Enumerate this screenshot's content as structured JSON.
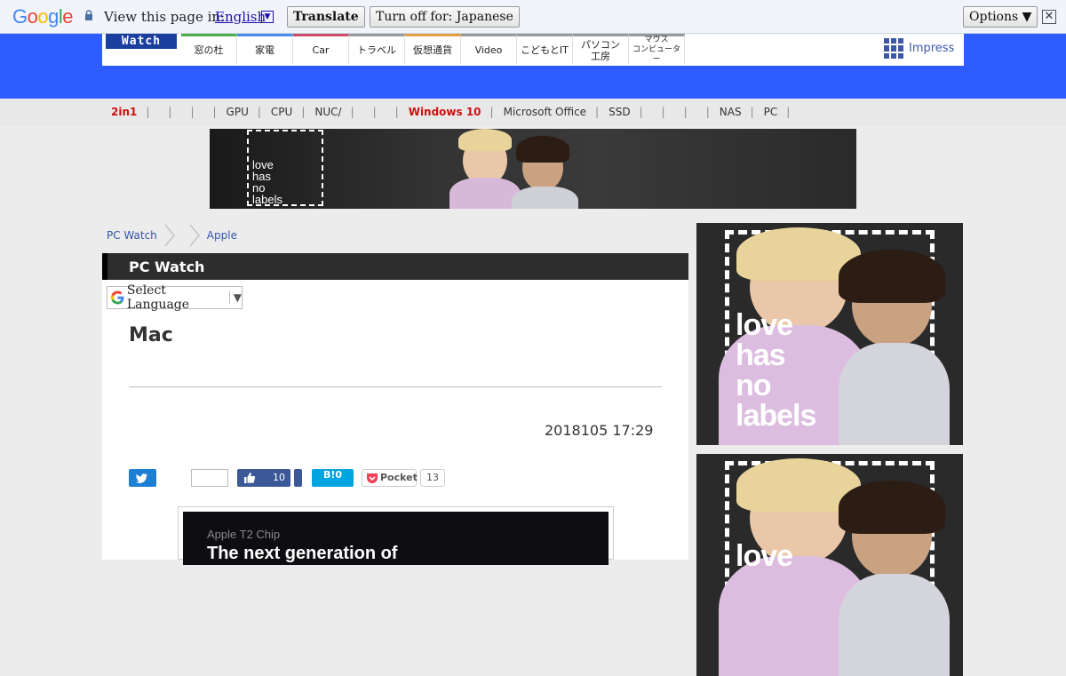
{
  "translate_bar": {
    "logo": "Google",
    "prompt": "View this page in:",
    "language": "English",
    "translate_button": "Translate",
    "turn_off_button": "Turn off for: Japanese",
    "options_button": "Options ▼",
    "close_glyph": "✕"
  },
  "header": {
    "logo_text": "Watch",
    "site_tabs": [
      {
        "label": "窓の杜",
        "color": "#4caf50"
      },
      {
        "label": "家電",
        "color": "#4a8de8"
      },
      {
        "label": "Car",
        "color": "#d04a6a"
      },
      {
        "label": "トラベル",
        "color": "#9a9a9a"
      },
      {
        "label": "仮想通貨",
        "color": "#e0a040"
      },
      {
        "label": "Video",
        "color": "#9a9a9a"
      },
      {
        "label": "こどもとIT",
        "color": "#9a9a9a"
      },
      {
        "label": "パソコン\n工房",
        "color": "#9a9a9a"
      },
      {
        "label": "マウス\nコンピューター",
        "color": "#9a9a9a"
      }
    ],
    "impress_label": "Impress"
  },
  "keywords": [
    "2in1",
    "|",
    "|",
    "|",
    "|",
    "GPU",
    "|",
    "CPU",
    "|",
    "NUC/",
    "|",
    "|",
    "|",
    "Windows 10",
    "|",
    "Microsoft Office",
    "|",
    "SSD",
    "|",
    "|",
    "|",
    "|",
    "NAS",
    "|",
    "PC",
    "|"
  ],
  "ads": {
    "banner_text": "love\nhas\nno\nlabels",
    "side1_text": "love\nhas\nno\nlabels",
    "side2_text": "love"
  },
  "breadcrumb": {
    "home": "PC Watch",
    "current": "Apple"
  },
  "section": {
    "title": "PC Watch"
  },
  "language_select": {
    "label": "Select Language",
    "arrow": "▼"
  },
  "article": {
    "title": "Mac",
    "date": "2018105 17:29",
    "image_caption": "Apple T2 Chip",
    "image_headline": "The next generation of"
  },
  "share": {
    "facebook_count": "10",
    "hatena_label": "B!0",
    "pocket_label": "Pocket",
    "pocket_count": "13"
  }
}
